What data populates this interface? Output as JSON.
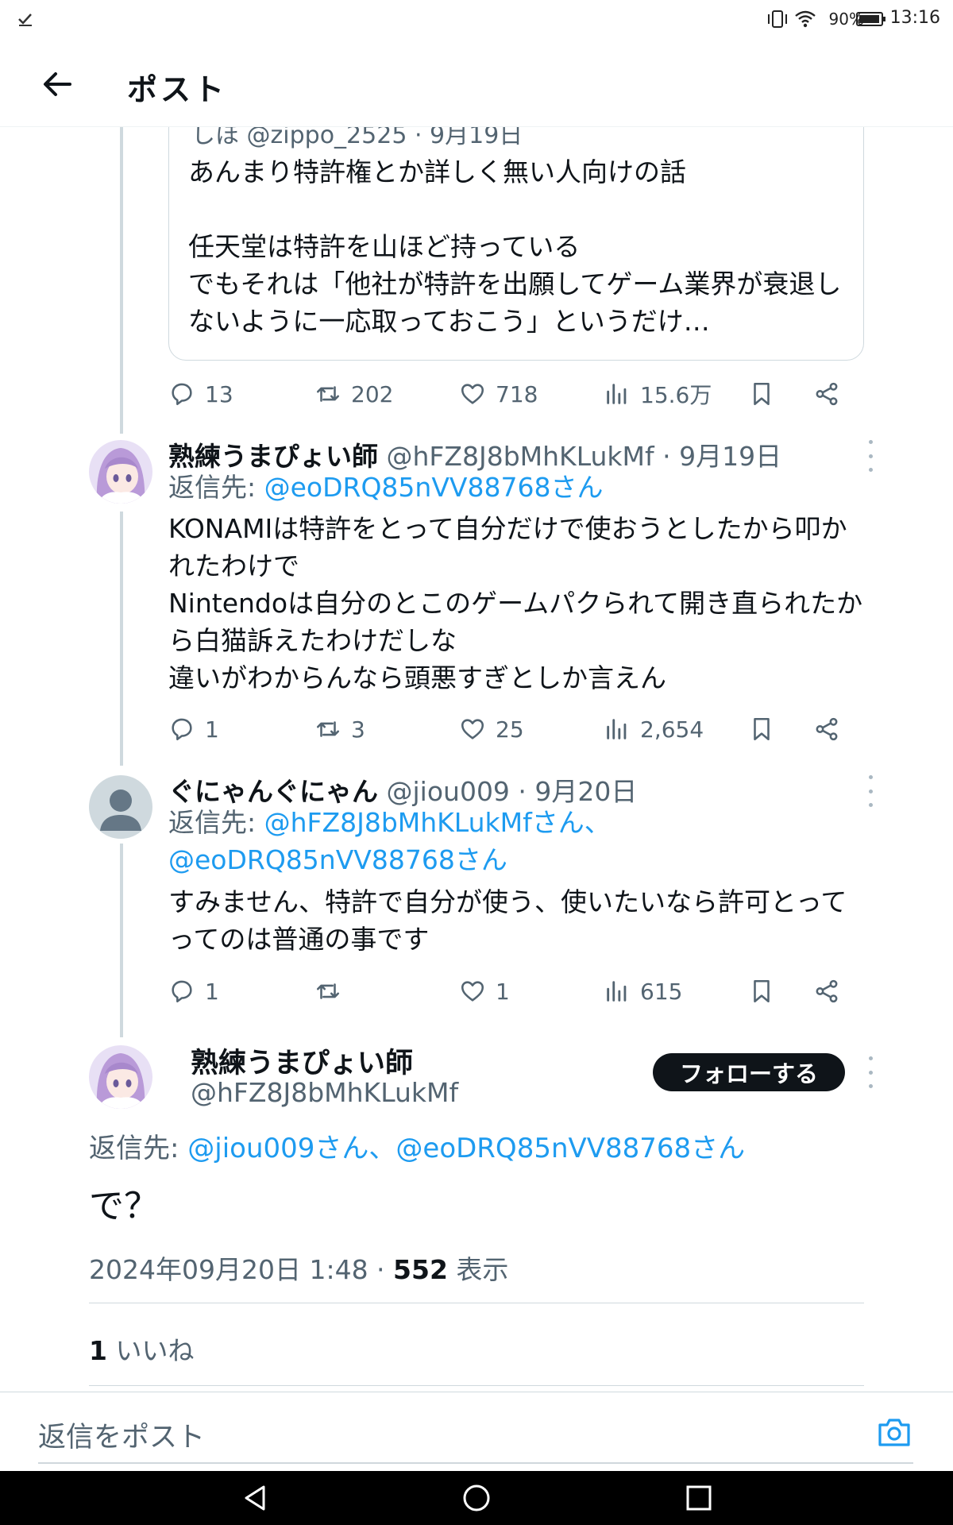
{
  "status_bar": {
    "time": "13:16",
    "battery": "90%"
  },
  "header": {
    "title": "ポスト"
  },
  "quoted_post": {
    "header": "しほ @zippo_2525 · 9月19日",
    "text": "あんまり特許権とか詳しく無い人向けの話\n\n任天堂は特許を山ほど持っている\nでもそれは「他社が特許を出願してゲーム業界が衰退しないように一応取っておこう」というだけ…"
  },
  "post0_actions": {
    "replies": "13",
    "reposts": "202",
    "likes": "718",
    "views": "15.6万"
  },
  "reply1": {
    "name": "熟練うまぴょい師",
    "handle": "@hFZ8J8bMhKLukMf",
    "date": " · 9月19日",
    "reply_prefix": "返信先: ",
    "reply_to": "@eoDRQ85nVV88768さん",
    "text": "KONAMIは特許をとって自分だけで使おうとしたから叩かれたわけで\nNintendoは自分のとこのゲームパクられて開き直られたから白猫訴えたわけだしな\n違いがわからんなら頭悪すぎとしか言えん",
    "replies": "1",
    "reposts": "3",
    "likes": "25",
    "views": "2,654"
  },
  "reply2": {
    "name": "ぐにゃんぐにゃん",
    "handle": "@jiou009",
    "date": " · 9月20日",
    "reply_prefix": "返信先: ",
    "reply_to_1": "@hFZ8J8bMhKLukMfさん、",
    "reply_to_2": "@eoDRQ85nVV88768さん",
    "text": "すみません、特許で自分が使う、使いたいなら許可とってってのは普通の事です",
    "replies": "1",
    "reposts": "",
    "likes": "1",
    "views": "615"
  },
  "main_post": {
    "name": "熟練うまぴょい師",
    "handle": "@hFZ8J8bMhKLukMf",
    "follow_label": "フォローする",
    "reply_prefix": "返信先: ",
    "reply_to": "@jiou009さん、@eoDRQ85nVV88768さん",
    "text": "で？",
    "timestamp": "2024年09月20日 1:48 · ",
    "views_count": "552",
    "views_label": " 表示",
    "likes_count": "1",
    "likes_label": " いいね"
  },
  "composer": {
    "placeholder": "返信をポスト"
  },
  "icons": [
    "back-arrow-icon",
    "reply-icon",
    "repost-icon",
    "like-icon",
    "views-icon",
    "bookmark-icon",
    "share-icon",
    "more-icon",
    "camera-icon",
    "nav-back-icon",
    "nav-home-icon",
    "nav-recents-icon"
  ],
  "colors": {
    "link": "#1d9bf0",
    "muted": "#536471",
    "text": "#0f1419"
  }
}
